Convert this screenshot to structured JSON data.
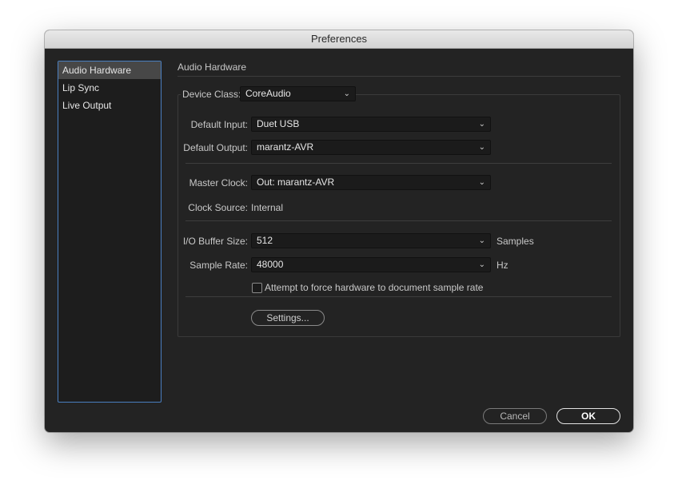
{
  "window": {
    "title": "Preferences"
  },
  "sidebar": {
    "items": [
      {
        "label": "Audio Hardware",
        "selected": true
      },
      {
        "label": "Lip Sync",
        "selected": false
      },
      {
        "label": "Live Output",
        "selected": false
      }
    ]
  },
  "panel": {
    "title": "Audio Hardware",
    "device_class": {
      "label": "Device Class:",
      "value": "CoreAudio"
    },
    "default_input": {
      "label": "Default Input:",
      "value": "Duet USB"
    },
    "default_output": {
      "label": "Default Output:",
      "value": "marantz-AVR"
    },
    "master_clock": {
      "label": "Master Clock:",
      "value": "Out: marantz-AVR"
    },
    "clock_source": {
      "label": "Clock Source:",
      "value": "Internal"
    },
    "buffer_size": {
      "label": "I/O Buffer Size:",
      "value": "512",
      "unit": "Samples"
    },
    "sample_rate": {
      "label": "Sample Rate:",
      "value": "48000",
      "unit": "Hz"
    },
    "force_rate": {
      "label": "Attempt to force hardware to document sample rate",
      "checked": false
    },
    "settings_button": "Settings..."
  },
  "footer": {
    "cancel_label": "Cancel",
    "ok_label": "OK"
  },
  "colors": {
    "selection_border": "#4a7fc1",
    "panel_bg": "#232323",
    "sidebar_selected": "#474747"
  },
  "icons": {
    "dropdown": "chevron-down-icon"
  }
}
